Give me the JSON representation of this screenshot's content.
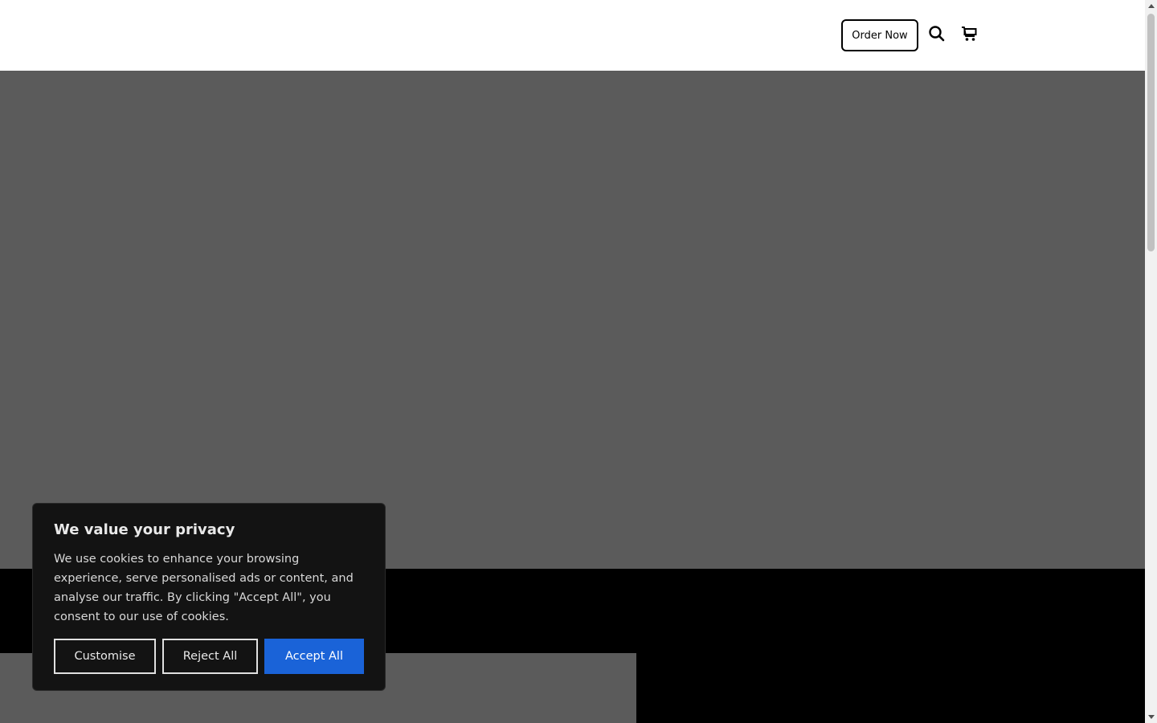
{
  "header": {
    "order_button_label": "Order Now",
    "icons": [
      "search-icon",
      "cart-icon"
    ]
  },
  "cookie_banner": {
    "title": "We value your privacy",
    "body": "We use cookies to enhance your browsing experience, serve personalised ads or content, and analyse our traffic. By clicking \"Accept All\", you consent to our use of cookies.",
    "customise_label": "Customise",
    "reject_label": "Reject All",
    "accept_label": "Accept All",
    "accept_color": "#1a63d8"
  },
  "colors": {
    "hero_bg": "#5b5b5b",
    "band_bg": "#000000",
    "banner_bg": "#131313"
  }
}
